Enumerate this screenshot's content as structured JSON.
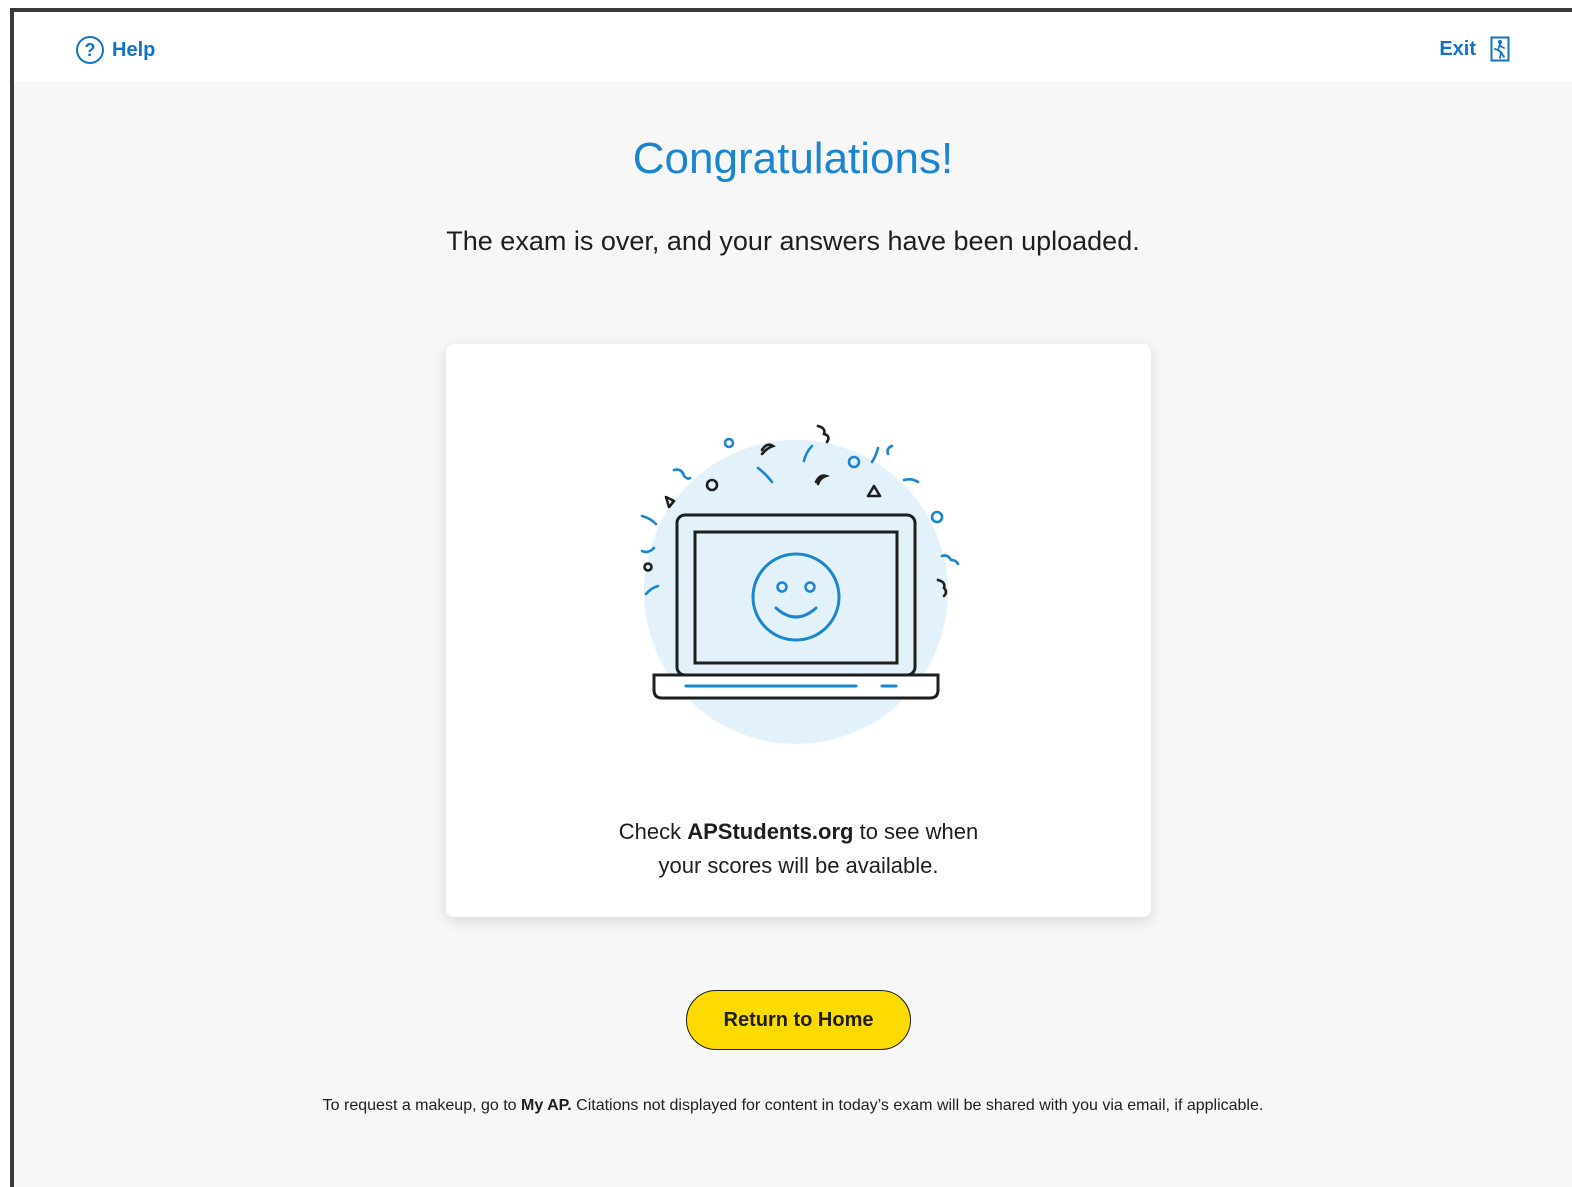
{
  "topbar": {
    "help_label": "Help",
    "help_icon": "question-circle-icon",
    "exit_label": "Exit",
    "exit_icon": "exit-door-icon"
  },
  "main": {
    "title": "Congratulations!",
    "subtitle": "The exam is over, and your answers have been uploaded."
  },
  "card": {
    "illustration_icon": "laptop-smiley-celebration-illustration",
    "text_prefix": "Check ",
    "text_link": "APStudents.org",
    "text_suffix_line1": " to see when",
    "text_line2": "your scores will be available."
  },
  "actions": {
    "return_label": "Return to Home"
  },
  "footer": {
    "prefix": "To request a makeup, go to ",
    "link": "My AP.",
    "suffix": " Citations not displayed for content in today’s exam will be shared with you via email, if applicable."
  },
  "colors": {
    "accent_blue": "#1a86cf",
    "link_blue": "#1273c5",
    "button_yellow": "#fedb00",
    "illustration_bg": "#e3f1fa",
    "background": "#f7f7f7"
  }
}
